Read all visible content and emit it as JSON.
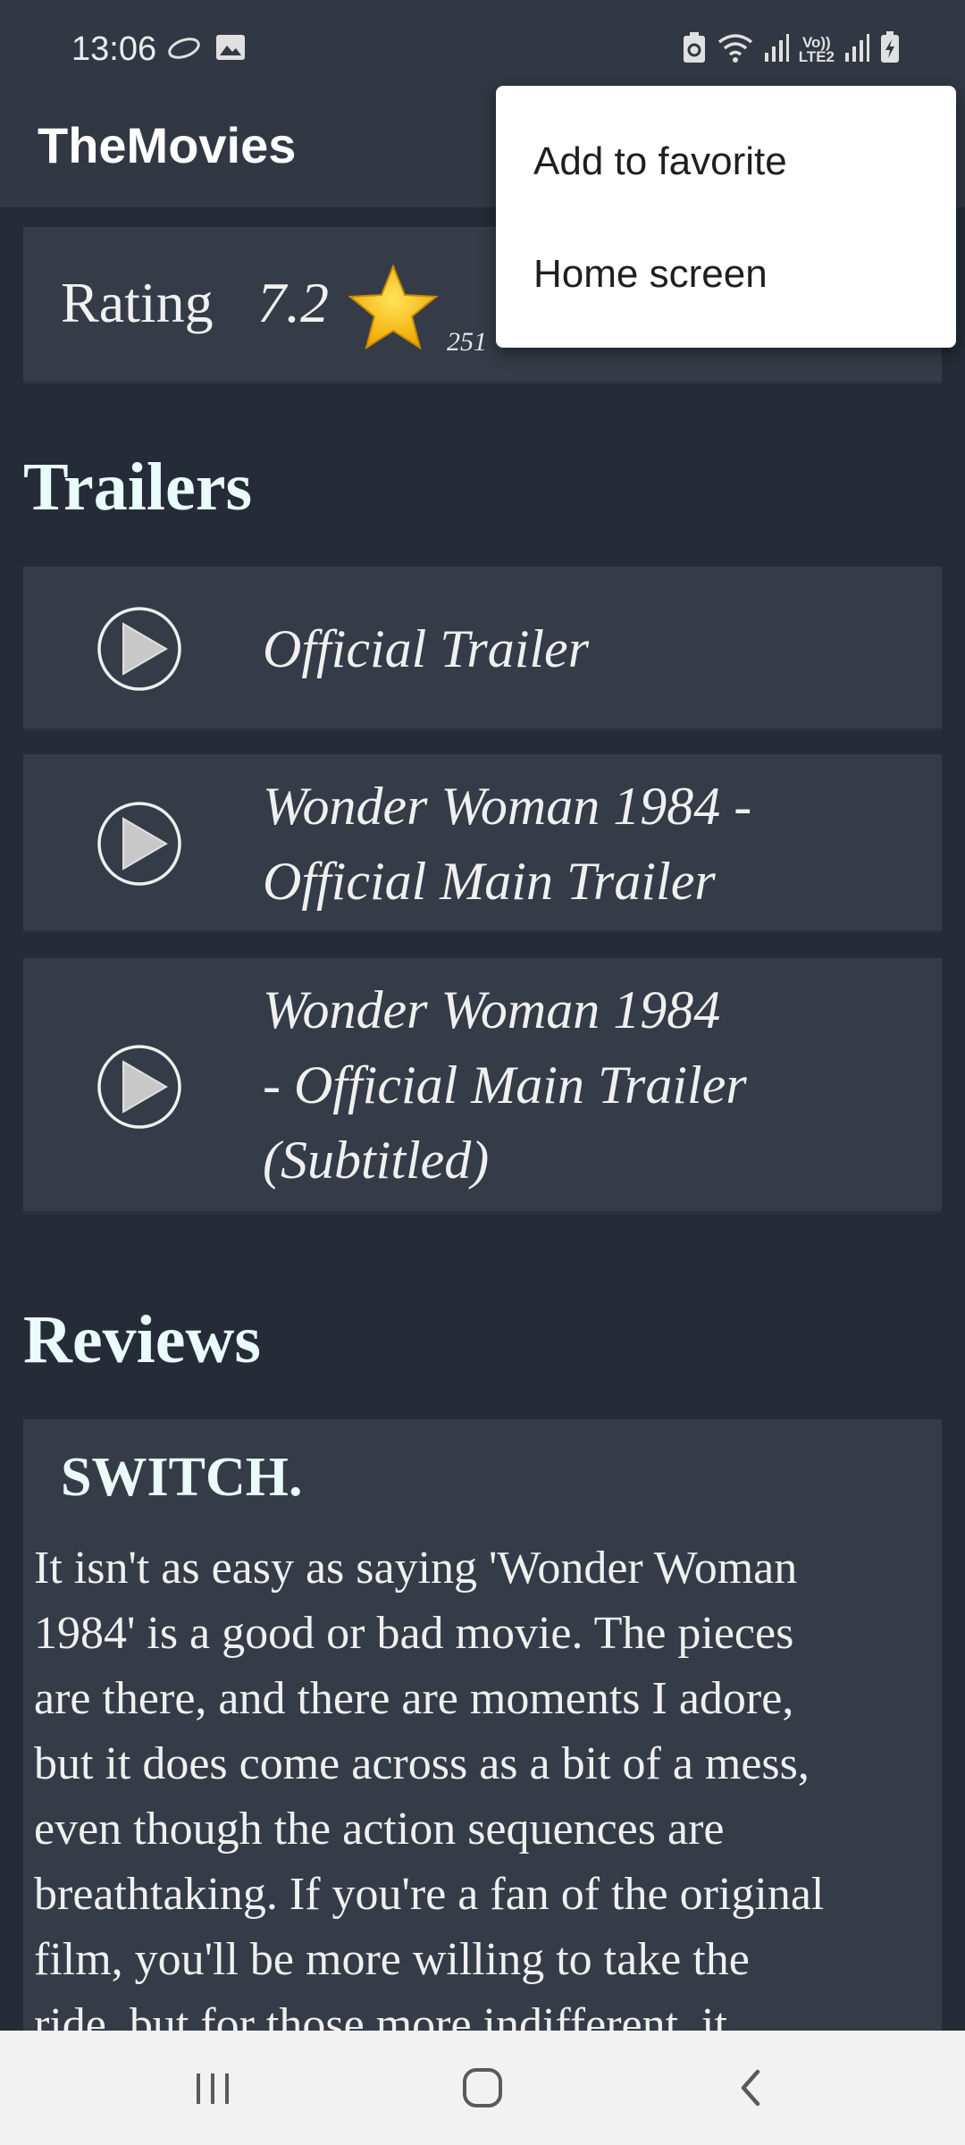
{
  "status_bar": {
    "time": "13:06",
    "icons": [
      "cloud-icon",
      "image-icon",
      "recycle-icon",
      "wifi-icon",
      "signal-icon",
      "volte-lte2-icon",
      "signal-icon",
      "battery-charging-icon"
    ],
    "volte_label_top": "Vo))",
    "volte_label_bottom": "LTE2"
  },
  "app_bar": {
    "title": "TheMovies"
  },
  "rating": {
    "label": "Rating",
    "value": "7.2",
    "count": "251",
    "star_icon": "star-icon",
    "star_color": "#f5b800"
  },
  "trailers": {
    "title": "Trailers",
    "items": [
      {
        "lines": [
          "Official Trailer"
        ]
      },
      {
        "lines": [
          "Wonder Woman 1984 -",
          "Official Main Trailer"
        ]
      },
      {
        "lines": [
          "Wonder Woman 1984",
          "- Official Main Trailer",
          "(Subtitled)"
        ]
      }
    ]
  },
  "reviews": {
    "title": "Reviews",
    "items": [
      {
        "author": "SWITCH.",
        "lines": [
          "It isn't as easy as saying 'Wonder Woman",
          "1984' is a good or bad movie. The pieces",
          "are there, and there are moments I adore,",
          "but it does come across as a bit of a mess,",
          "even though the action sequences are",
          "breathtaking. If you're a fan of the original",
          "film, you'll be more willing to take the",
          "ride, but for those more indifferent, it"
        ]
      }
    ]
  },
  "menu": {
    "items": [
      {
        "label": "Add to favorite"
      },
      {
        "label": "Home screen"
      }
    ]
  },
  "nav_bar": {
    "icons": [
      "recents-icon",
      "home-icon",
      "back-icon"
    ]
  },
  "colors": {
    "background": "#252c37",
    "card": "#353c47",
    "app_bar": "#313843",
    "heading": "#e9fbfb"
  }
}
